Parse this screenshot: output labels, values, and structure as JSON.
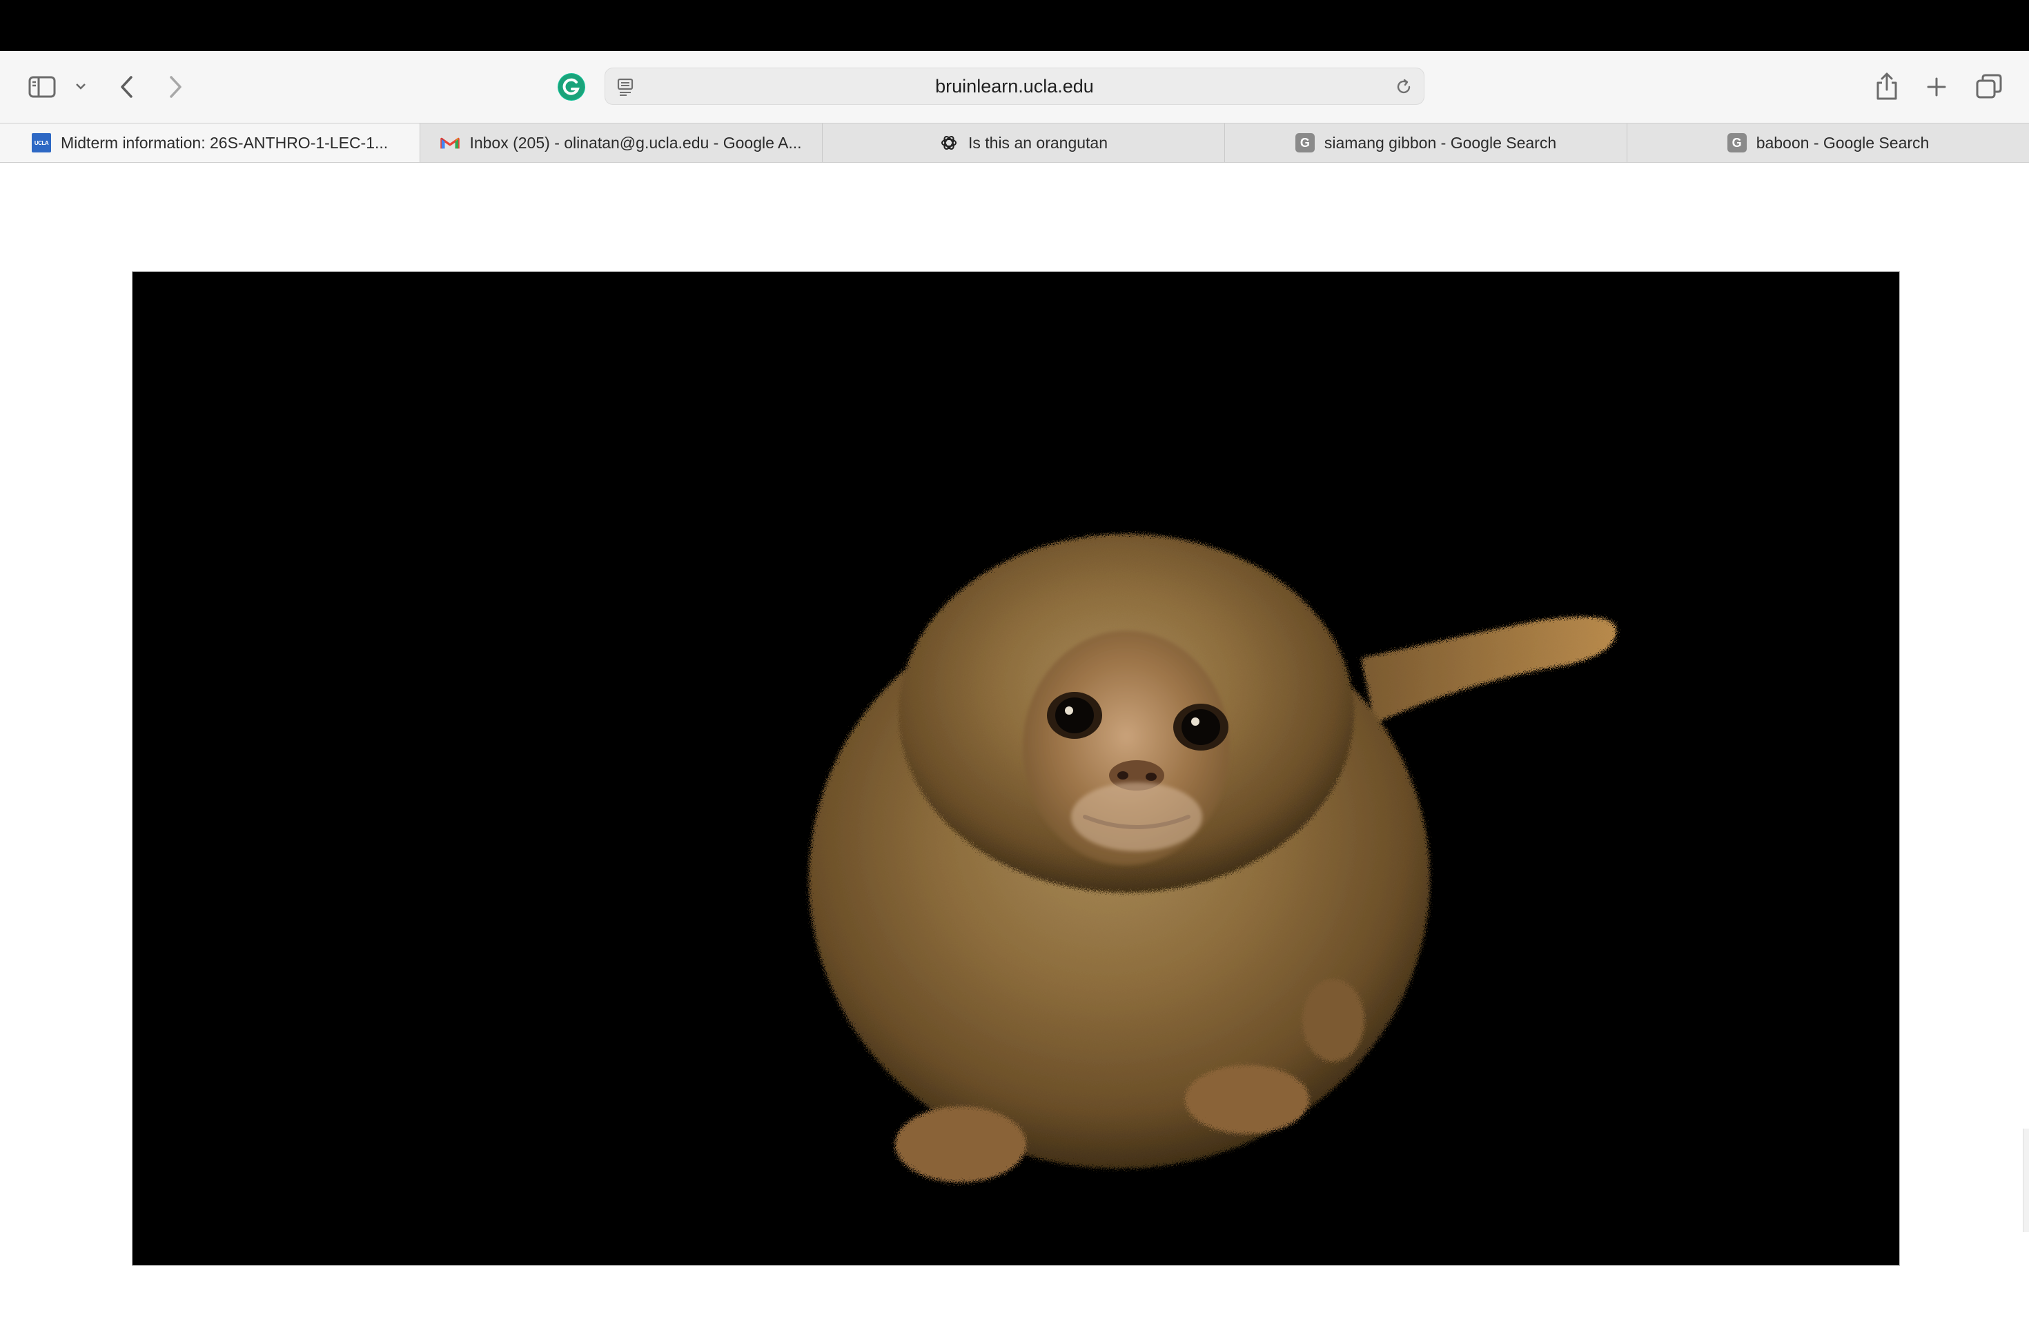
{
  "browser": {
    "address_url": "bruinlearn.ucla.edu",
    "tabs": [
      {
        "title": "Midterm information: 26S-ANTHRO-1-LEC-1...",
        "icon": "ucla-favicon-icon",
        "favicon_text": "UCLA",
        "active": true
      },
      {
        "title": "Inbox (205) - olinatan@g.ucla.edu - Google A...",
        "icon": "gmail-icon",
        "active": false
      },
      {
        "title": "Is this an orangutan",
        "icon": "chatgpt-icon",
        "active": false
      },
      {
        "title": "siamang gibbon - Google Search",
        "icon": "google-g-icon",
        "favicon_text": "G",
        "active": false
      },
      {
        "title": "baboon - Google Search",
        "icon": "google-g-icon",
        "favicon_text": "G",
        "active": false
      }
    ],
    "toolbar_icons": [
      "sidebar-icon",
      "chevron-down-icon",
      "back-icon",
      "forward-icon",
      "grammarly-icon",
      "reader-icon",
      "reload-icon",
      "share-icon",
      "new-tab-icon",
      "tab-overview-icon"
    ]
  },
  "page": {
    "image_subject": "pygmy-marmoset-photo",
    "colors": {
      "image_background": "#000000",
      "fur": "#8a6a3a"
    }
  }
}
